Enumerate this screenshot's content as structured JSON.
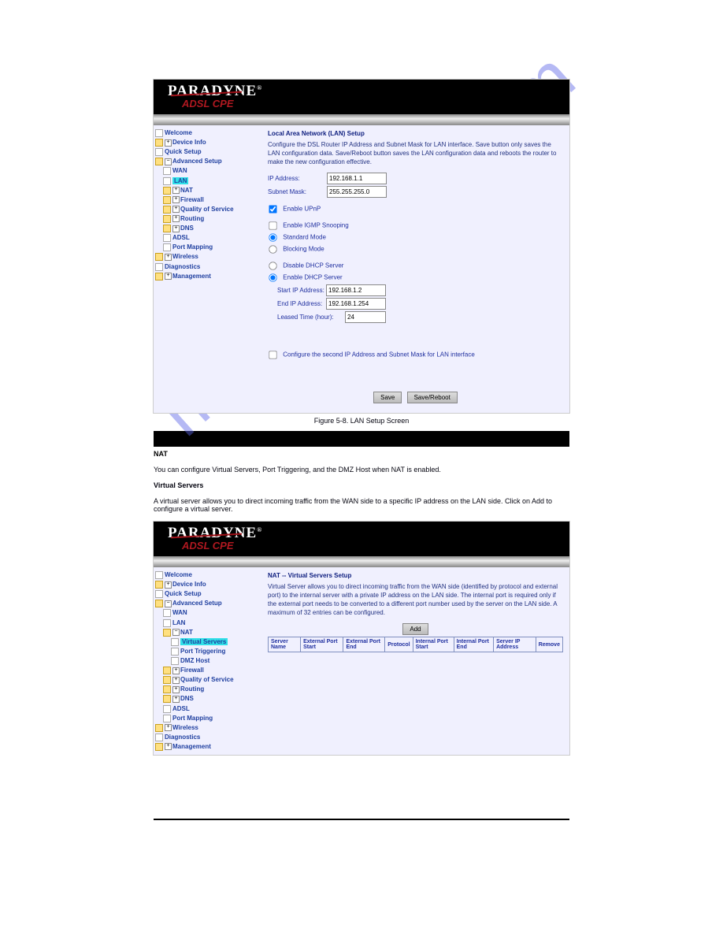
{
  "watermark": "manualshive.com",
  "section1": {
    "brand": "PARADYNE",
    "subbrand": "ADSL CPE",
    "nav": {
      "welcome": "Welcome",
      "device": "Device Info",
      "quick": "Quick Setup",
      "advanced": "Advanced Setup",
      "wan": "WAN",
      "lan": "LAN",
      "nat": "NAT",
      "firewall": "Firewall",
      "qos": "Quality of Service",
      "routing": "Routing",
      "dns": "DNS",
      "adsl": "ADSL",
      "portmap": "Port Mapping",
      "wireless": "Wireless",
      "diag": "Diagnostics",
      "mgmt": "Management"
    },
    "title": "Local Area Network (LAN) Setup",
    "desc": "Configure the DSL Router IP Address and Subnet Mask for LAN interface.  Save button only saves the LAN configuration data.  Save/Reboot button saves the LAN configuration data and reboots the router to make the new configuration effective.",
    "ip_label": "IP Address:",
    "ip_value": "192.168.1.1",
    "subnet_label": "Subnet Mask:",
    "subnet_value": "255.255.255.0",
    "upnp": "Enable UPnP",
    "igmp": "Enable IGMP Snooping",
    "std": "Standard Mode",
    "blk": "Blocking Mode",
    "dhcp_off": "Disable DHCP Server",
    "dhcp_on": "Enable DHCP Server",
    "start_label": "Start IP Address:",
    "start_value": "192.168.1.2",
    "end_label": "End IP Address:",
    "end_value": "192.168.1.254",
    "lease_label": "Leased Time (hour):",
    "lease_value": "24",
    "second_ip": "Configure the second IP Address and Subnet Mask for LAN interface",
    "save": "Save",
    "savereboot": "Save/Reboot",
    "caption": "Figure 5-8. LAN Setup Screen"
  },
  "nat_section": {
    "heading": "NAT",
    "text1": "You can configure Virtual Servers, Port Triggering, and the DMZ Host when NAT is enabled.",
    "vs_heading": "Virtual Servers",
    "text2": "A virtual server allows you to direct incoming traffic from the WAN side to a specific IP address on the LAN side. Click on Add to configure a virtual server."
  },
  "section2": {
    "brand": "PARADYNE",
    "subbrand": "ADSL CPE",
    "nav": {
      "welcome": "Welcome",
      "device": "Device Info",
      "quick": "Quick Setup",
      "advanced": "Advanced Setup",
      "wan": "WAN",
      "lan": "LAN",
      "nat": "NAT",
      "virtual": "Virtual Servers",
      "trigger": "Port Triggering",
      "dmz": "DMZ Host",
      "firewall": "Firewall",
      "qos": "Quality of Service",
      "routing": "Routing",
      "dns": "DNS",
      "adsl": "ADSL",
      "portmap": "Port Mapping",
      "wireless": "Wireless",
      "diag": "Diagnostics",
      "mgmt": "Management"
    },
    "title": "NAT -- Virtual Servers Setup",
    "desc": "Virtual Server allows you to direct incoming traffic from the WAN side (identified by protocol and external port) to the internal server with a private IP address on the LAN side. The internal port is required only if the external port needs to be converted to a different port number used by the server on the LAN side. A maximum of 32 entries can be configured.",
    "add": "Add",
    "cols": {
      "c1": "Server Name",
      "c2": "External Port Start",
      "c3": "External Port End",
      "c4": "Protocol",
      "c5": "Internal Port Start",
      "c6": "Internal Port End",
      "c7": "Server IP Address",
      "c8": "Remove"
    }
  }
}
